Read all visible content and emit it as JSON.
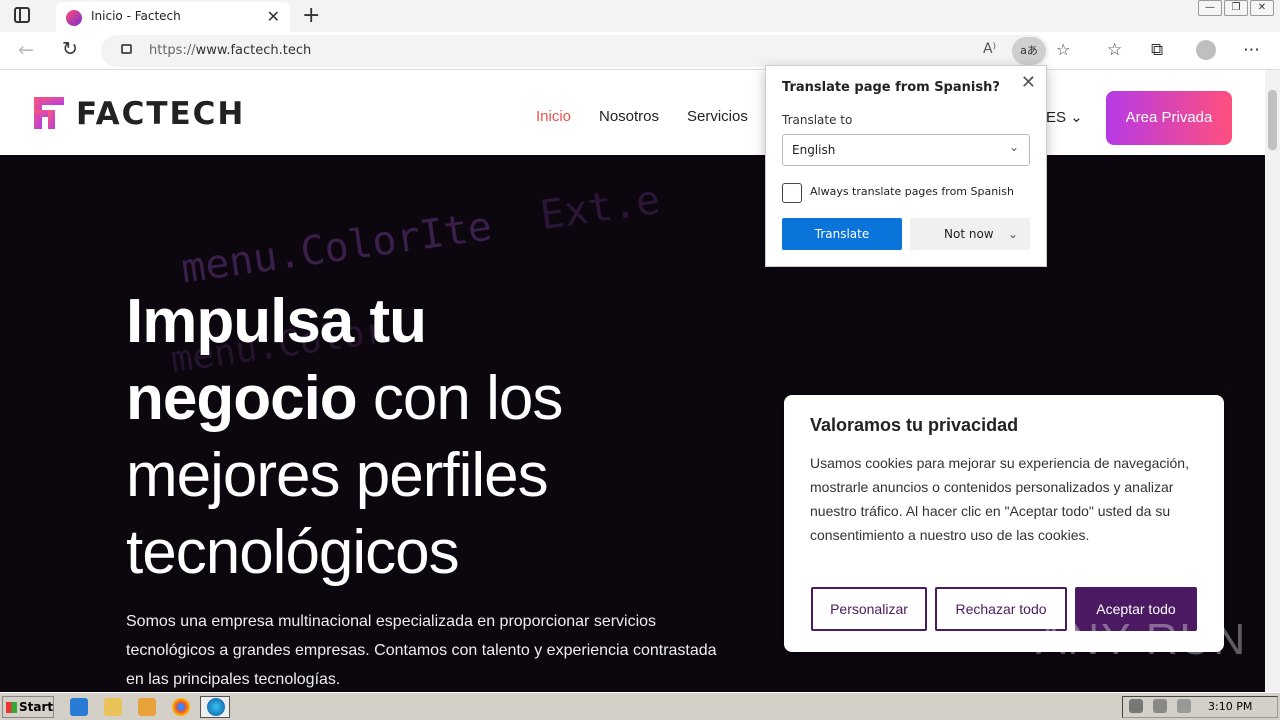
{
  "browser": {
    "tab_title": "Inicio - Factech",
    "url_scheme": "https://",
    "url_host": "www.factech.tech",
    "translate_icon_text": "aあ",
    "read_aloud_icon": "read-aloud-icon",
    "new_tab_symbol": "+",
    "close_tab_symbol": "✕"
  },
  "site": {
    "logo_text": "FACTECH",
    "nav": {
      "inicio": "Inicio",
      "nosotros": "Nosotros",
      "servicios": "Servicios",
      "language": "ES"
    },
    "area_privada": "Area Privada",
    "accent_color": "#e8534a"
  },
  "hero": {
    "headline_bold1": "Impulsa tu",
    "headline_bold2": "negocio",
    "headline_rest2": " con los",
    "headline_line3": "mejores perfiles",
    "headline_line4": "tecnológicos",
    "paragraph": "Somos una empresa multinacional especializada en proporcionar servicios tecnológicos a grandes empresas. Contamos con talento y experiencia contrastada en las principales tecnologías."
  },
  "cookie": {
    "title": "Valoramos tu privacidad",
    "body": "Usamos cookies para mejorar su experiencia de navegación, mostrarle anuncios o contenidos personalizados y analizar nuestro tráfico. Al hacer clic en \"Aceptar todo\" usted da su consentimiento a nuestro uso de las cookies.",
    "customize": "Personalizar",
    "reject": "Rechazar todo",
    "accept": "Aceptar todo"
  },
  "translate_popup": {
    "title": "Translate page from Spanish?",
    "translate_to_label": "Translate to",
    "selected_language": "English",
    "always_label": "Always translate pages from Spanish",
    "always_checked": false,
    "translate_button": "Translate",
    "not_now_button": "Not now"
  },
  "watermark": "ANY RUN",
  "taskbar": {
    "start_label": "Start",
    "clock": "3:10 PM"
  }
}
